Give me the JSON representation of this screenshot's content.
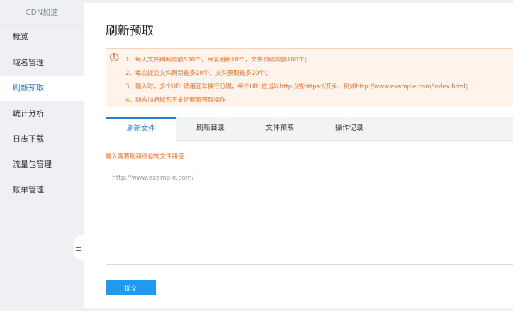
{
  "sidebar": {
    "title": "CDN加速",
    "items": [
      {
        "label": "概览"
      },
      {
        "label": "域名管理"
      },
      {
        "label": "刷新预取"
      },
      {
        "label": "统计分析"
      },
      {
        "label": "日志下载"
      },
      {
        "label": "流量包管理"
      },
      {
        "label": "账单管理"
      }
    ],
    "active_index": 2
  },
  "main": {
    "title": "刷新预取",
    "notice": {
      "icon": "alert-circle-icon",
      "lines": [
        "1、每天文件刷新限额500个，目录刷新10个，文件预取限额100个；",
        "2、每次提交文件刷新最多20个，文件预取最多20个；",
        "3、输入时，多个URL请用回车换行分隔，每个URL应当以http://或https://开头，例如http://www.example.com/index.html；",
        "4、动态加速域名不支持刷新预取操作"
      ]
    },
    "tabs": [
      {
        "label": "刷新文件"
      },
      {
        "label": "刷新目录"
      },
      {
        "label": "文件预取"
      },
      {
        "label": "操作记录"
      }
    ],
    "active_tab": 0,
    "hint": "输入需要刷新缓存的文件路径",
    "input": {
      "placeholder": "http://www.example.com/",
      "value": ""
    },
    "submit_label": "提交"
  },
  "colors": {
    "accent": "#2b7ae0",
    "warning": "#f07024",
    "button": "#1e9bf0",
    "sidebar_bg": "#eef0f3"
  }
}
